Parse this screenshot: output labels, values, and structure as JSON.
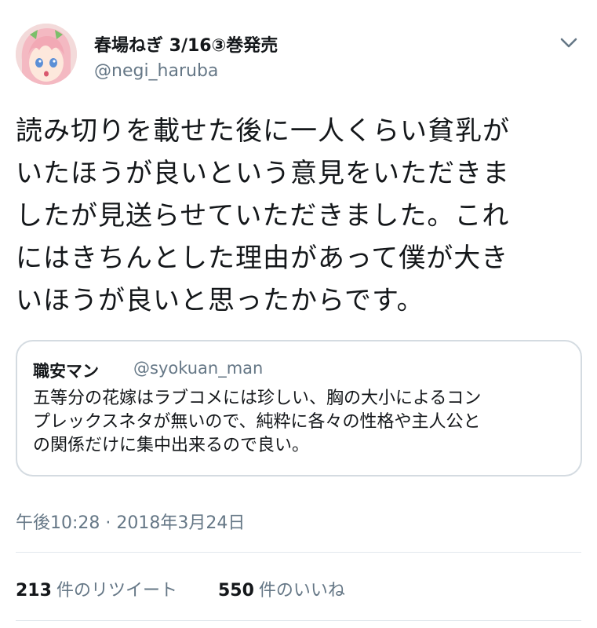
{
  "tweet": {
    "author": {
      "display_name": "春場ねぎ 3/16③巻発売",
      "handle": "@negi_haruba"
    },
    "text": "読み切りを載せた後に一人くらい貧乳が\nいたほうが良いという意見をいただきま\nしたが見送らせていただきました。これ\nにはきちんとした理由があって僕が大き\nいほうが良いと思ったからです。",
    "quoted_tweet": {
      "display_name": "職安マン",
      "handle": "@syokuan_man",
      "text": "五等分の花嫁はラブコメには珍しい、胸の大小によるコン\nプレックスネタが無いので、純粋に各々の性格や主人公と\nの関係だけに集中出来るので良い。"
    },
    "timestamp": "午後10:28 · 2018年3月24日",
    "stats": {
      "retweets_count": "213",
      "retweets_label": "件のリツイート",
      "likes_count": "550",
      "likes_label": "件のいいね"
    }
  },
  "icons": {
    "caret": "chevron-down-icon",
    "avatar": "avatar"
  },
  "colors": {
    "text_primary": "#14171a",
    "text_secondary": "#657786",
    "border": "#d4dbe1",
    "divider": "#e1e8ed"
  }
}
